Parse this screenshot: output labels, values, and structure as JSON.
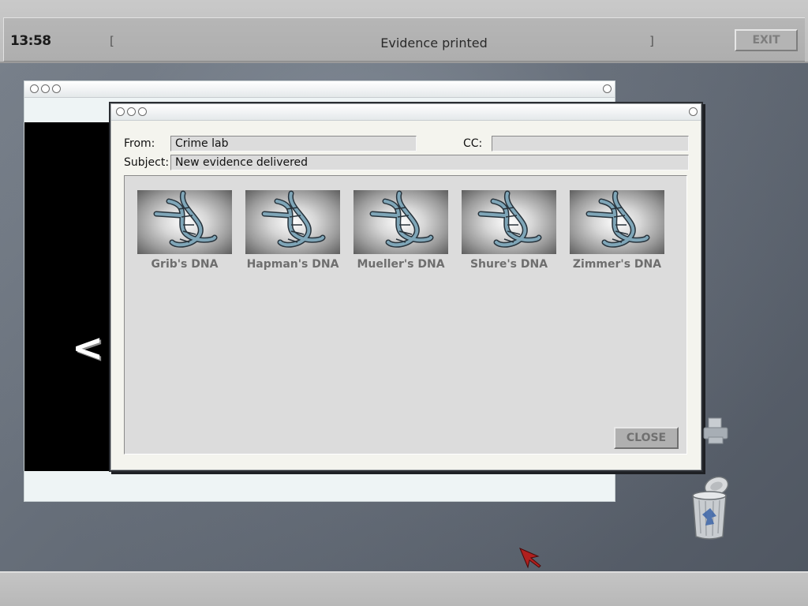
{
  "topbar": {
    "clock": "13:58",
    "bracket_left": "[",
    "bracket_right": "]",
    "title": "Evidence printed",
    "exit_label": "EXIT"
  },
  "back_window": {
    "nav_arrow": "<"
  },
  "message": {
    "from_label": "From:",
    "from_value": "Crime lab",
    "cc_label": "CC:",
    "cc_value": "",
    "subject_label": "Subject:",
    "subject_value": "New evidence delivered",
    "attachments": [
      {
        "label": "Grib's DNA",
        "icon": "dna-icon"
      },
      {
        "label": "Hapman's DNA",
        "icon": "dna-icon"
      },
      {
        "label": "Mueller's DNA",
        "icon": "dna-icon"
      },
      {
        "label": "Shure's DNA",
        "icon": "dna-icon"
      },
      {
        "label": "Zimmer's DNA",
        "icon": "dna-icon"
      }
    ],
    "close_label": "CLOSE"
  },
  "desktop": {
    "icons": [
      "printer-icon",
      "trash-icon"
    ]
  },
  "colors": {
    "desktop": "#5e6672",
    "bar": "#bdbdbd",
    "window": "#f4f4ee",
    "panel": "#dcdcdc"
  }
}
